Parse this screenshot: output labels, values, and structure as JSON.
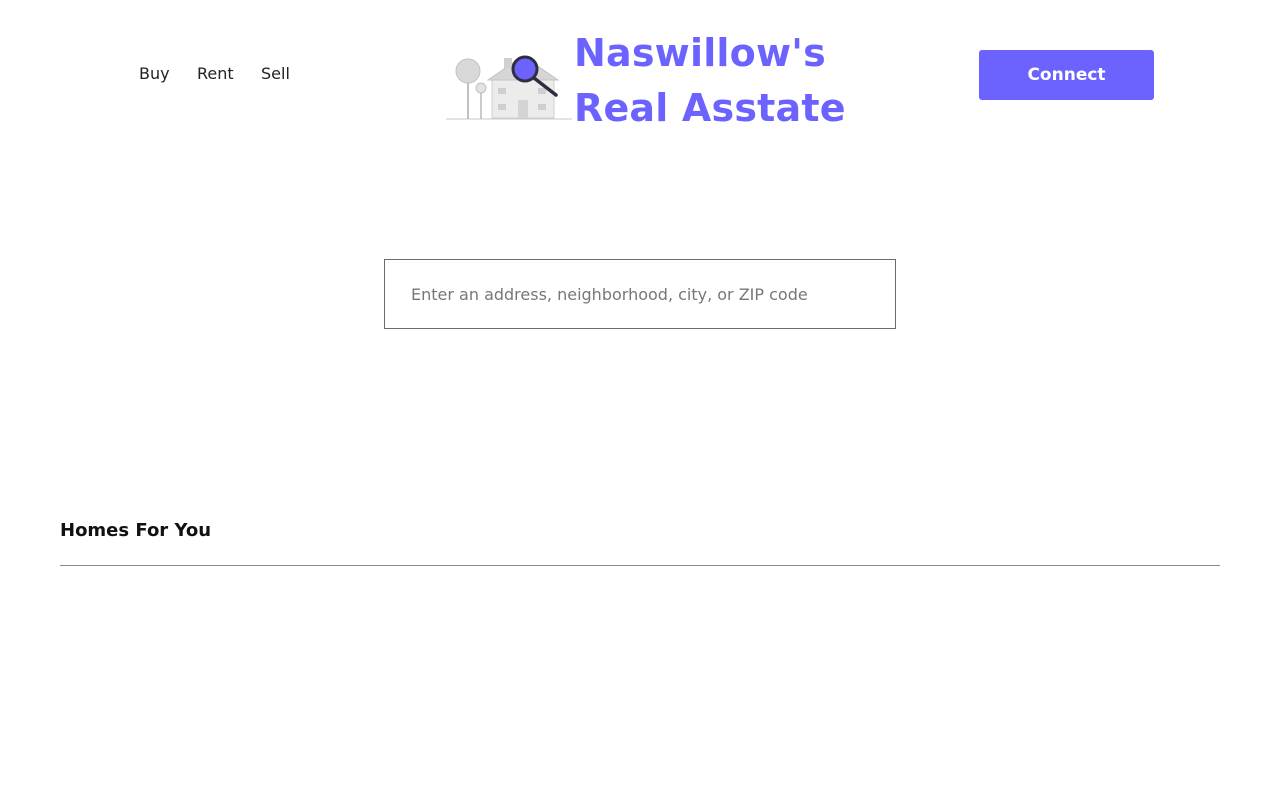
{
  "nav": {
    "items": [
      "Buy",
      "Rent",
      "Sell"
    ]
  },
  "brand": {
    "line1": "Naswillow's",
    "line2": "Real Asstate",
    "color": "#6c63ff",
    "illustration": "house-with-magnifier-icon"
  },
  "header": {
    "connect_label": "Connect"
  },
  "search": {
    "value": "",
    "placeholder": "Enter an address, neighborhood, city, or ZIP code"
  },
  "homes": {
    "title": "Homes For You"
  },
  "colors": {
    "accent": "#6c63ff",
    "divider": "#8a8a8a"
  }
}
